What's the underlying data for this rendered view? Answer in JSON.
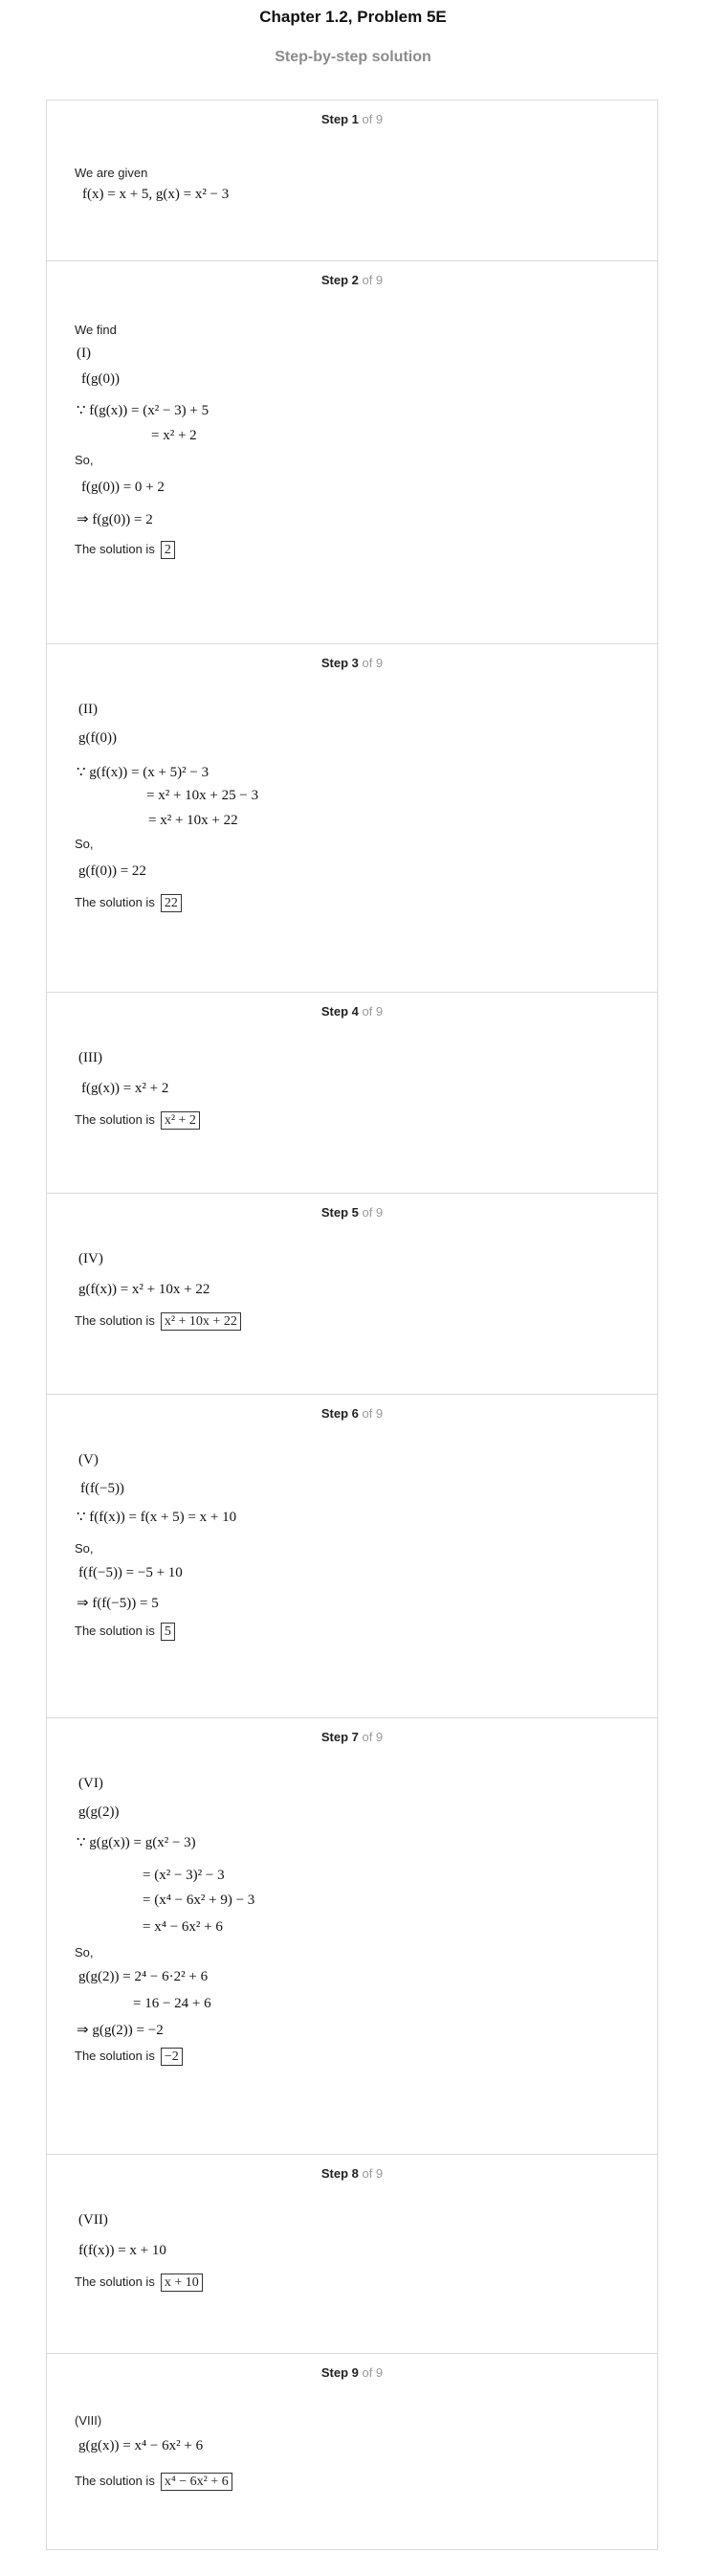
{
  "header": {
    "title": "Chapter 1.2, Problem 5E",
    "subtitle": "Step-by-step solution"
  },
  "step_of_label": "of 9",
  "steps": [
    {
      "label": "Step 1",
      "lines": [
        {
          "kind": "text",
          "text": "We are given"
        },
        {
          "kind": "math",
          "text": "f(x) = x + 5,     g(x) = x² − 3"
        }
      ]
    },
    {
      "label": "Step 2",
      "lines": [
        {
          "kind": "text",
          "text": "We find"
        },
        {
          "kind": "math",
          "text": "(I)"
        },
        {
          "kind": "math",
          "text": "f(g(0))"
        },
        {
          "kind": "math",
          "text": "∵ f(g(x)) = (x² − 3) + 5"
        },
        {
          "kind": "math",
          "text": "= x² + 2"
        },
        {
          "kind": "text",
          "text": "So,"
        },
        {
          "kind": "math",
          "text": "f(g(0)) = 0 + 2"
        },
        {
          "kind": "math",
          "text": "⇒ f(g(0)) = 2"
        },
        {
          "kind": "text",
          "text": "The solution is",
          "answer": "2"
        }
      ]
    },
    {
      "label": "Step 3",
      "lines": [
        {
          "kind": "math",
          "text": "(II)"
        },
        {
          "kind": "math",
          "text": "g(f(0))"
        },
        {
          "kind": "math",
          "text": "∵ g(f(x)) = (x + 5)² − 3"
        },
        {
          "kind": "math",
          "text": "= x² + 10x + 25 − 3"
        },
        {
          "kind": "math",
          "text": "= x² + 10x + 22"
        },
        {
          "kind": "text",
          "text": "So,"
        },
        {
          "kind": "math",
          "text": "g(f(0)) = 22"
        },
        {
          "kind": "text",
          "text": "The solution is",
          "answer": "22"
        }
      ]
    },
    {
      "label": "Step 4",
      "lines": [
        {
          "kind": "math",
          "text": "(III)"
        },
        {
          "kind": "math",
          "text": "f(g(x)) = x² + 2"
        },
        {
          "kind": "text",
          "text": "The solution is",
          "answer": "x² + 2"
        }
      ]
    },
    {
      "label": "Step 5",
      "lines": [
        {
          "kind": "math",
          "text": "(IV)"
        },
        {
          "kind": "math",
          "text": "g(f(x)) = x² + 10x + 22"
        },
        {
          "kind": "text",
          "text": "The solution is",
          "answer": "x² + 10x + 22"
        }
      ]
    },
    {
      "label": "Step 6",
      "lines": [
        {
          "kind": "math",
          "text": "(V)"
        },
        {
          "kind": "math",
          "text": "f(f(−5))"
        },
        {
          "kind": "math",
          "text": "∵ f(f(x)) = f(x + 5) = x + 10"
        },
        {
          "kind": "text",
          "text": "So,"
        },
        {
          "kind": "math",
          "text": "f(f(−5)) = −5 + 10"
        },
        {
          "kind": "math",
          "text": "⇒ f(f(−5)) = 5"
        },
        {
          "kind": "text",
          "text": "The solution is",
          "answer": "5"
        }
      ]
    },
    {
      "label": "Step 7",
      "lines": [
        {
          "kind": "math",
          "text": "(VI)"
        },
        {
          "kind": "math",
          "text": "g(g(2))"
        },
        {
          "kind": "math",
          "text": "∵ g(g(x)) = g(x² − 3)"
        },
        {
          "kind": "math",
          "text": "= (x² − 3)² − 3"
        },
        {
          "kind": "math",
          "text": "= (x⁴ − 6x² + 9) − 3"
        },
        {
          "kind": "math",
          "text": "= x⁴ − 6x² + 6"
        },
        {
          "kind": "text",
          "text": "So,"
        },
        {
          "kind": "math",
          "text": "g(g(2)) = 2⁴ − 6·2² + 6"
        },
        {
          "kind": "math",
          "text": "= 16 − 24 + 6"
        },
        {
          "kind": "math",
          "text": "⇒ g(g(2)) = −2"
        },
        {
          "kind": "text",
          "text": "The solution is",
          "answer": "−2"
        }
      ]
    },
    {
      "label": "Step 8",
      "lines": [
        {
          "kind": "math",
          "text": "(VII)"
        },
        {
          "kind": "math",
          "text": "f(f(x)) = x + 10"
        },
        {
          "kind": "text",
          "text": "The solution is",
          "answer": "x + 10"
        }
      ]
    },
    {
      "label": "Step 9",
      "lines": [
        {
          "kind": "text",
          "text": "(VIII)"
        },
        {
          "kind": "math",
          "text": "g(g(x)) = x⁴ − 6x² + 6"
        },
        {
          "kind": "text",
          "text": "The solution is",
          "answer": "x⁴ − 6x² + 6"
        }
      ]
    }
  ]
}
